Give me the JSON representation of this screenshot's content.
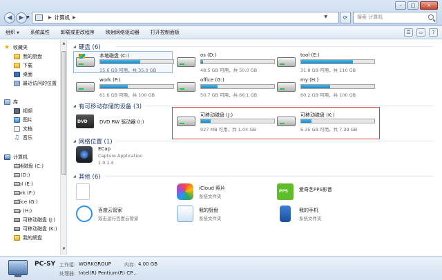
{
  "address": {
    "location": "计算机",
    "search_placeholder": "搜索 计算机"
  },
  "toolbar": {
    "organize": "组织",
    "system_properties": "系统属性",
    "uninstall": "卸载或更改程序",
    "map_drive": "映射网络驱动器",
    "control_panel": "打开控制面板"
  },
  "sidebar": {
    "favorites": "收藏夹",
    "netdisk": "我的厨盘",
    "downloads": "下载",
    "desktop": "桌面",
    "recent": "最近访问的位置",
    "libraries": "库",
    "videos": "视频",
    "pictures": "图片",
    "documents": "文档",
    "music": "音乐",
    "computer": "计算机",
    "drives": [
      "本地磁盘 (C:)",
      "os (D:)",
      "tool (E:)",
      "work (F:)",
      "office (G:)",
      "my (H:)",
      "可移动磁盘 (J:)",
      "可移动磁盘 (K:)"
    ],
    "netdisk2": "我的網盘"
  },
  "groups": {
    "hdd": "硬盘 (6)",
    "removable": "有可移动存储的设备 (3)",
    "network": "网络位置 (1)",
    "other": "其他 (6)"
  },
  "drives": [
    {
      "name": "本地磁盘 (C:)",
      "info": "15.6 GB 可用，共 35.0 GB",
      "fill": 0.55
    },
    {
      "name": "os (D:)",
      "info": "48.5 GB 可用，共 50.0 GB",
      "fill": 0.03
    },
    {
      "name": "tool (E:)",
      "info": "31.8 GB 可用，共 110 GB",
      "fill": 0.71
    },
    {
      "name": "work (F:)",
      "info": "61.6 GB 可用，共 100 GB",
      "fill": 0.38
    },
    {
      "name": "office (G:)",
      "info": "50.7 GB 可用，共 66.1 GB",
      "fill": 0.23
    },
    {
      "name": "my (H:)",
      "info": "60.2 GB 可用，共 100 GB",
      "fill": 0.4
    }
  ],
  "removable": [
    {
      "name": "DVD RW 驱动器 (I:)"
    },
    {
      "name": "可移动磁盘 (J:)",
      "info": "927 MB 可用，共 1.04 GB",
      "fill": 0.13
    },
    {
      "name": "可移动磁盘 (K:)",
      "info": "6.35 GB 可用，共 7.39 GB",
      "fill": 0.14
    }
  ],
  "network": {
    "name": "ECap",
    "desc": "Capture Application",
    "version": "1.0.1.4"
  },
  "other": [
    {
      "name": ""
    },
    {
      "name": "iCloud 照片",
      "desc": "系统文件夹"
    },
    {
      "name": "爱奇艺PPS影音",
      "desc": ""
    },
    {
      "name": "百度云管家",
      "desc": "双击运行百度云管家"
    },
    {
      "name": "我的厨盘",
      "desc": "系统文件夹"
    },
    {
      "name": "我的手机",
      "desc": "系统文件夹"
    }
  ],
  "status": {
    "pc_name": "PC-SY",
    "workgroup_label": "工作组:",
    "workgroup_value": "WORKGROUP",
    "memory_label": "内存:",
    "memory_value": "4.00 GB",
    "cpu_label": "处理器:",
    "cpu_value": "Intel(R) Pentium(R) CP..."
  },
  "colors": {
    "bar_fill": "#1e88c7",
    "highlight_border": "#c74545",
    "group_heading": "#1e3a6e"
  }
}
